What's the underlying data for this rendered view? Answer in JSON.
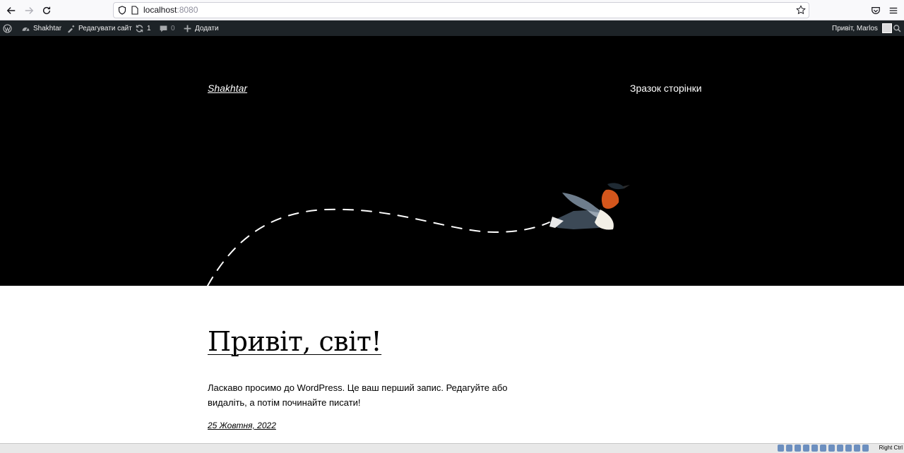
{
  "browser": {
    "url_host": "localhost",
    "url_port": ":8080"
  },
  "admin_bar": {
    "site_name": "Shakhtar",
    "edit_site": "Редагувати сайт",
    "updates_count": "1",
    "comments_count": "0",
    "add_new": "Додати",
    "greeting": "Привіт, Marlos"
  },
  "header": {
    "site_title": "Shakhtar",
    "nav_item": "Зразок сторінки"
  },
  "post": {
    "title": "Привіт, світ!",
    "excerpt": "Ласкаво просимо до WordPress. Це ваш перший запис. Редагуйте або видаліть, а потім починайте писати!",
    "date": "25 Жовтня, 2022"
  },
  "status_bar": {
    "host_key": "Right Ctrl"
  },
  "colors": {
    "admin_bar_bg": "#1d2327",
    "header_bg": "#000000",
    "bird_breast": "#d4561c"
  }
}
